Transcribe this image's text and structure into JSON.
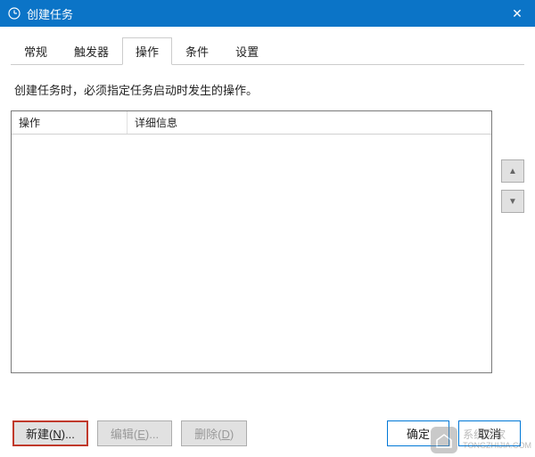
{
  "titlebar": {
    "title": "创建任务"
  },
  "tabs": {
    "items": [
      {
        "label": "常规"
      },
      {
        "label": "触发器"
      },
      {
        "label": "操作"
      },
      {
        "label": "条件"
      },
      {
        "label": "设置"
      }
    ],
    "active_index": 2
  },
  "description": "创建任务时，必须指定任务启动时发生的操作。",
  "table": {
    "columns": {
      "action": "操作",
      "detail": "详细信息"
    }
  },
  "side": {
    "up": "▲",
    "down": "▼"
  },
  "buttons": {
    "new": "新建(N)...",
    "edit": "编辑(E)...",
    "delete": "删除(D)"
  },
  "dialog": {
    "ok": "确定",
    "cancel": "取消"
  },
  "watermark": {
    "name": "系统之家",
    "url": "TONGZHIJIA.COM"
  }
}
